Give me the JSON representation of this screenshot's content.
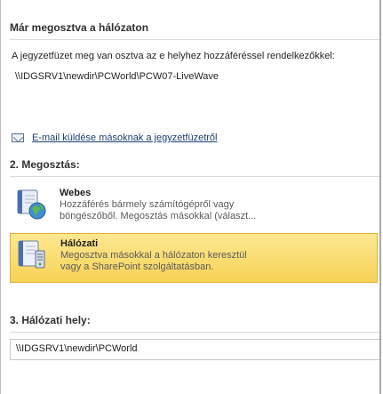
{
  "shared": {
    "header": "Már megosztva a hálózaton",
    "description": "A jegyzetfüzet meg van osztva az e helyhez hozzáféréssel rendelkezőkkel:",
    "path": "\\\\IDGSRV1\\newdir\\PCWorld\\PCW07-LiveWave",
    "email_link": "E-mail küldése másoknak a jegyzetfüzetről",
    "email_icon": "envelope-icon"
  },
  "sharing": {
    "header": "2. Megosztás:",
    "options": [
      {
        "title": "Webes",
        "desc_line1": "Hozzáférés bármely számítógépről vagy",
        "desc_line2": "böngészőből. Megosztás másokkal (választ...",
        "icon": "web-globe-icon",
        "selected": false
      },
      {
        "title": "Hálózati",
        "desc_line1": "Megosztva másokkal a hálózaton keresztül",
        "desc_line2": "vagy a SharePoint szolgáltatásban.",
        "icon": "network-server-icon",
        "selected": true
      }
    ]
  },
  "location": {
    "header": "3. Hálózati hely:",
    "value": "\\\\IDGSRV1\\newdir\\PCWorld"
  }
}
